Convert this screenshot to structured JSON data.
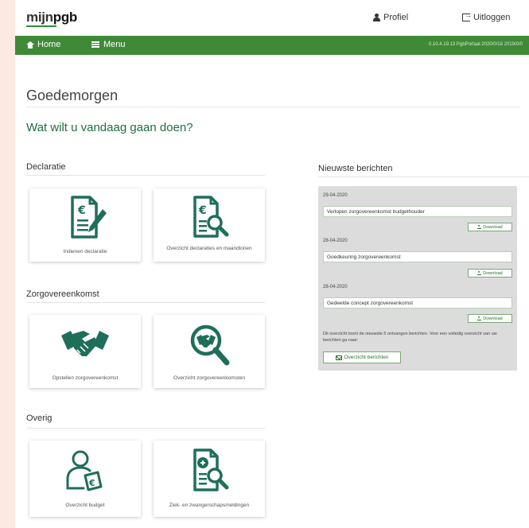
{
  "header": {
    "logo_mijn": "mijn",
    "logo_pgb": "pgb",
    "profile_label": "Profiel",
    "logout_label": "Uitloggen"
  },
  "nav": {
    "home_label": "Home",
    "menu_label": "Menu",
    "version_text": "0.10.4.19.13 PgbPortaal 2020/0/18 2019/0/0"
  },
  "main": {
    "greeting": "Goedemorgen",
    "question": "Wat wilt u vandaag gaan doen?"
  },
  "sections": {
    "declaratie": {
      "title": "Declaratie",
      "tiles": [
        {
          "label": "Indienen declaratie",
          "icon": "invoice-pen-icon"
        },
        {
          "label": "Overzicht declaraties en maandlonen",
          "icon": "invoice-search-icon"
        }
      ]
    },
    "zorgovereenkomst": {
      "title": "Zorgovereenkomst",
      "tiles": [
        {
          "label": "Opstellen zorgovereenkomst",
          "icon": "handshake-icon"
        },
        {
          "label": "Overzicht zorgovereenkomsten",
          "icon": "handshake-search-icon"
        }
      ]
    },
    "overig": {
      "title": "Overig",
      "tiles": [
        {
          "label": "Overzicht budget",
          "icon": "person-euro-icon"
        },
        {
          "label": "Ziek- en zwangerschapsmeldingen",
          "icon": "medical-document-search-icon"
        }
      ]
    }
  },
  "news": {
    "title": "Nieuwste berichten",
    "messages": [
      {
        "date": "29-04-2020",
        "subject": "Verlopen zorgovereenkomst budgethouder",
        "download_label": "Download"
      },
      {
        "date": "28-04-2020",
        "subject": "Goedkeuring zorgovereenkomst",
        "download_label": "Download"
      },
      {
        "date": "28-04-2020",
        "subject": "Gedeelde concept zorgovereenkomst",
        "download_label": "Download"
      }
    ],
    "note": "Dit overzicht toont de nieuwste 5 ontvangen berichten. Voor een volledig overzicht van uw berichten ga naar:",
    "overview_button": "Overzicht berichten"
  },
  "colors": {
    "brand_green": "#3f8a36",
    "icon_green": "#1f6e5b",
    "text_green": "#1f6e3e"
  }
}
